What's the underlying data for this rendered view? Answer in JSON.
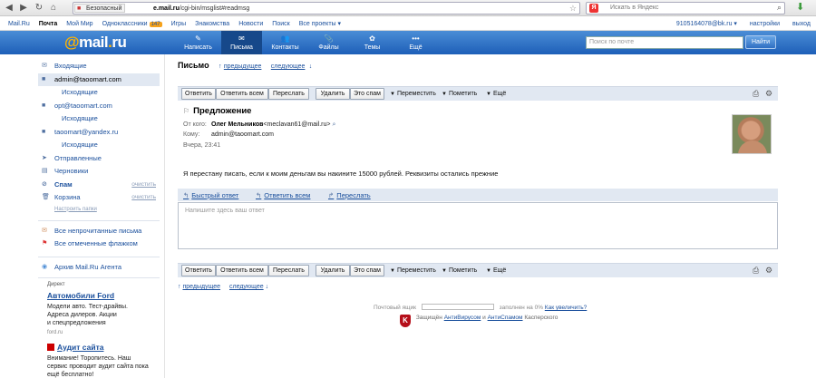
{
  "browser": {
    "security_label": "Безопасный",
    "url_host": "e.mail.ru",
    "url_path": "/cgi-bin/msglist#readmsg",
    "search_placeholder": "Искать в Яндекс"
  },
  "portal": {
    "links": [
      "Mail.Ru",
      "Почта",
      "Мой Мир",
      "Одноклассники",
      "Игры",
      "Знакомства",
      "Новости",
      "Поиск",
      "Все проекты ▾"
    ],
    "active_link": "Почта",
    "odnoklassniki_count": "147",
    "user_email": "9105164078@bk.ru ▾",
    "settings_label": "настройки",
    "logout_label": "выход"
  },
  "header": {
    "logo_at": "@",
    "logo_name": "mail",
    "logo_dot": ".",
    "logo_tld": "ru",
    "nav": [
      {
        "label": "Написать",
        "icon": "✎"
      },
      {
        "label": "Письма",
        "icon": "✉"
      },
      {
        "label": "Контакты",
        "icon": "👥"
      },
      {
        "label": "Файлы",
        "icon": "📎"
      },
      {
        "label": "Темы",
        "icon": "✿"
      },
      {
        "label": "Ещё",
        "icon": "•••"
      }
    ],
    "search_placeholder": "Поиск по почте",
    "search_button": "Найти"
  },
  "sidebar": {
    "folders": [
      {
        "label": "Входящие",
        "sub": false
      },
      {
        "label": "admin@taoomart.com",
        "sub": false
      },
      {
        "label": "Исходящие",
        "sub": true
      },
      {
        "label": "opt@taoomart.com",
        "sub": false
      },
      {
        "label": "Исходящие",
        "sub": true
      },
      {
        "label": "taoomart@yandex.ru",
        "sub": false
      },
      {
        "label": "Исходящие",
        "sub": true
      },
      {
        "label": "Отправленные",
        "sub": false
      },
      {
        "label": "Черновики",
        "sub": false
      },
      {
        "label": "Спам",
        "sub": false
      },
      {
        "label": "Корзина",
        "sub": false
      }
    ],
    "clean_label": "очистить",
    "folder_settings": "Настроить папки",
    "unread_label": "Все непрочитанные письма",
    "flagged_label": "Все отмеченные флажком",
    "agent_label": "Архив Mail.Ru Агента",
    "ad": {
      "label": "Директ",
      "title": "Автомобили Ford",
      "text_lines": [
        "Модели авто. Тест-драйвы.",
        "Адреса дилеров. Акции",
        "и спецпредложения"
      ],
      "url": "ford.ru"
    },
    "ad2": {
      "title": "Аудит сайта",
      "text_lines": [
        "Внимание! Торопитесь. Наш",
        "сервис проводит аудит сайта пока",
        "ещё бесплатно!"
      ]
    }
  },
  "message": {
    "view_title": "Письмо",
    "prev_label": "предыдущее",
    "next_label": "следующее",
    "toolbar": {
      "reply": "Ответить",
      "reply_all": "Ответить всем",
      "forward": "Переслать",
      "delete": "Удалить",
      "spam": "Это спам",
      "move": "Переместить",
      "mark": "Пометить",
      "more": "Ещё"
    },
    "subject": "Предложение",
    "from_label": "От кого:",
    "from_name": "Олег Мельников",
    "from_email": "<meclavan61@mail.ru>",
    "to_label": "Кому:",
    "to_value": "admin@taoomart.com",
    "date": "Вчера, 23:41",
    "body": "Я перестану писать, если к моим деньгам вы накините 15000 рублей. Реквизиты остались прежние",
    "quick_reply": "Быстрый ответ",
    "reply_all_link": "Ответить всем",
    "forward_link": "Переслать",
    "reply_placeholder": "Напишите здесь ваш ответ"
  },
  "footer": {
    "quota_label": "Почтовый ящик",
    "quota_text": "заполнен на 0%",
    "quota_percent": 0,
    "quota_link": "Как увеличить?",
    "kasp_prefix": "Защищён",
    "kasp_av": "АнтиВирусом",
    "kasp_and": "и",
    "kasp_as": "АнтиСпамом",
    "kasp_suffix": "Касперского"
  }
}
